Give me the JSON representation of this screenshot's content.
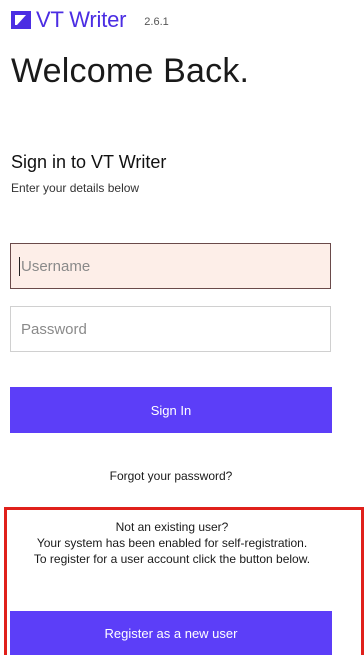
{
  "brand": {
    "name": "VT Writer",
    "version": "2.6.1",
    "logo_icon": "vt-logo-icon",
    "color": "#4b2de3"
  },
  "welcome": "Welcome Back.",
  "signin": {
    "title": "Sign in to VT Writer",
    "subtitle": "Enter your details below",
    "username_placeholder": "Username",
    "username_value": "",
    "password_placeholder": "Password",
    "password_value": "",
    "button_label": "Sign In",
    "forgot_label": "Forgot your password?"
  },
  "register": {
    "line1": "Not an existing user?",
    "line2": "Your system has been enabled for self-registration.",
    "line3": "To register for a user account click the button below.",
    "button_label": "Register as a new user",
    "highlight_color": "#e0201b"
  },
  "colors": {
    "primary_button": "#5c3ef8",
    "focused_input_bg": "#fdeee8"
  }
}
